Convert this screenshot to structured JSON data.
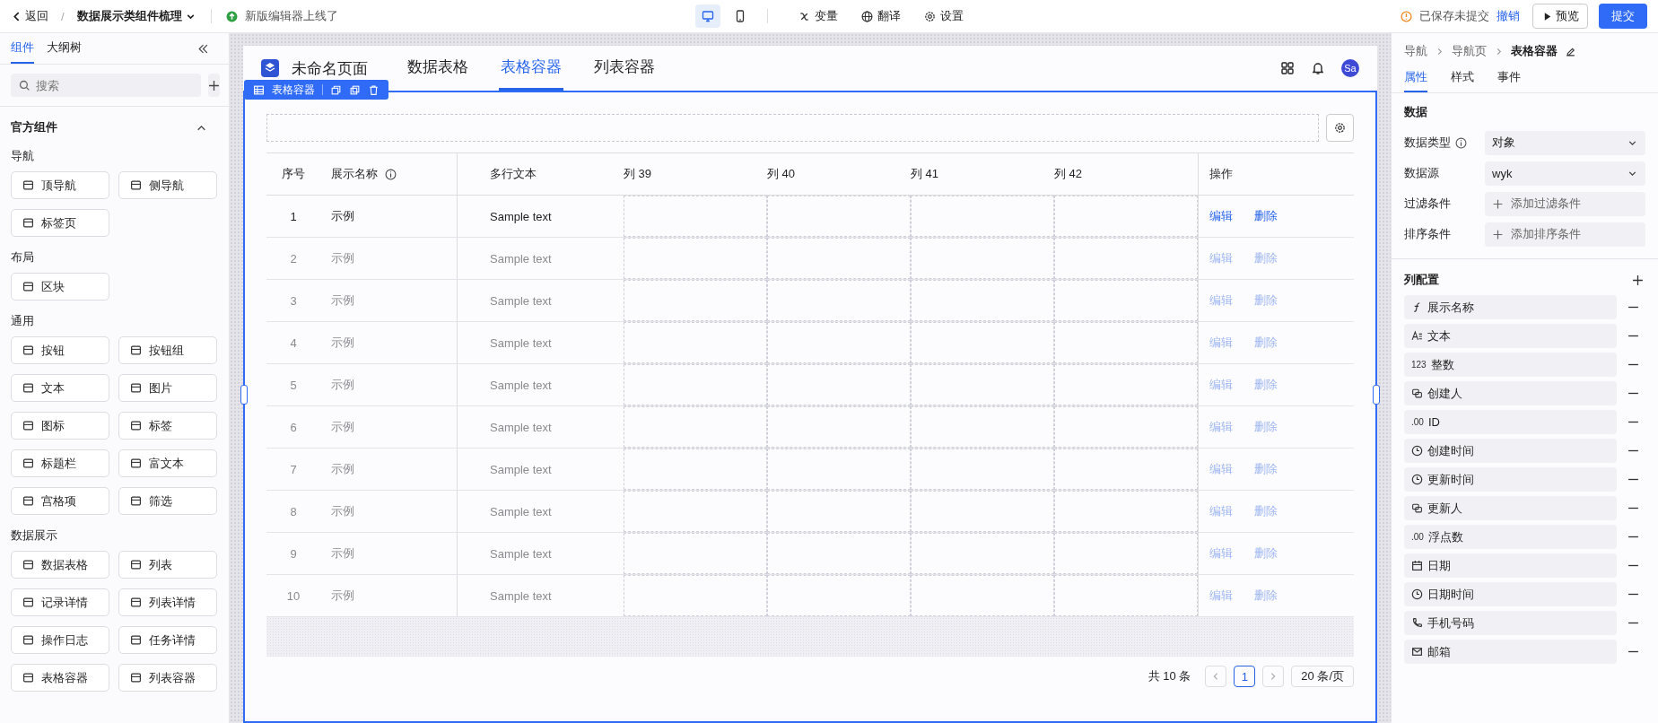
{
  "topbar": {
    "back": "返回",
    "separator": "/",
    "project": "数据展示类组件梳理",
    "notice": "新版编辑器上线了",
    "devices": [
      {
        "kind": "desktop",
        "selected": true
      },
      {
        "kind": "mobile",
        "selected": false
      }
    ],
    "tools": [
      {
        "kind": "variable",
        "label": "变量"
      },
      {
        "kind": "translate",
        "label": "翻译"
      },
      {
        "kind": "settings",
        "label": "设置"
      }
    ],
    "status": "已保存未提交",
    "undo": "撤销",
    "preview": "预览",
    "submit": "提交"
  },
  "sidebar": {
    "tabs": [
      {
        "label": "组件",
        "selected": true
      },
      {
        "label": "大纲树",
        "selected": false
      }
    ],
    "search": {
      "placeholder": "搜索"
    },
    "section": {
      "title": "官方组件",
      "expanded": true
    },
    "groups": [
      {
        "title": "导航",
        "items": [
          "顶导航",
          "侧导航",
          "标签页"
        ]
      },
      {
        "title": "布局",
        "items": [
          "区块"
        ]
      },
      {
        "title": "通用",
        "items": [
          "按钮",
          "按钮组",
          "文本",
          "图片",
          "图标",
          "标签",
          "标题栏",
          "富文本",
          "宫格项",
          "筛选"
        ]
      },
      {
        "title": "数据展示",
        "items": [
          "数据表格",
          "列表",
          "记录详情",
          "列表详情",
          "操作日志",
          "任务详情",
          "表格容器",
          "列表容器"
        ]
      }
    ]
  },
  "page": {
    "title": "未命名页面",
    "tabs": [
      {
        "label": "数据表格",
        "selected": false
      },
      {
        "label": "表格容器",
        "selected": true
      },
      {
        "label": "列表容器",
        "selected": false
      }
    ],
    "avatar": "Sa",
    "selection_toolbar": {
      "label": "表格容器"
    },
    "table": {
      "columns": [
        {
          "kind": "index",
          "label": "序号"
        },
        {
          "kind": "name",
          "label": "展示名称",
          "info": true
        },
        {
          "kind": "text",
          "label": "多行文本"
        },
        {
          "kind": "empty",
          "label": "列 39"
        },
        {
          "kind": "empty",
          "label": "列 40"
        },
        {
          "kind": "empty",
          "label": "列 41"
        },
        {
          "kind": "empty",
          "label": "列 42"
        },
        {
          "kind": "actions",
          "label": "操作"
        }
      ],
      "rows": [
        {
          "index": "1",
          "name": "示例",
          "text": "Sample text",
          "actions": [
            "编辑",
            "删除"
          ],
          "dimmed": false
        },
        {
          "index": "2",
          "name": "示例",
          "text": "Sample text",
          "actions": [
            "编辑",
            "删除"
          ],
          "dimmed": true
        },
        {
          "index": "3",
          "name": "示例",
          "text": "Sample text",
          "actions": [
            "编辑",
            "删除"
          ],
          "dimmed": true
        },
        {
          "index": "4",
          "name": "示例",
          "text": "Sample text",
          "actions": [
            "编辑",
            "删除"
          ],
          "dimmed": true
        },
        {
          "index": "5",
          "name": "示例",
          "text": "Sample text",
          "actions": [
            "编辑",
            "删除"
          ],
          "dimmed": true
        },
        {
          "index": "6",
          "name": "示例",
          "text": "Sample text",
          "actions": [
            "编辑",
            "删除"
          ],
          "dimmed": true
        },
        {
          "index": "7",
          "name": "示例",
          "text": "Sample text",
          "actions": [
            "编辑",
            "删除"
          ],
          "dimmed": true
        },
        {
          "index": "8",
          "name": "示例",
          "text": "Sample text",
          "actions": [
            "编辑",
            "删除"
          ],
          "dimmed": true
        },
        {
          "index": "9",
          "name": "示例",
          "text": "Sample text",
          "actions": [
            "编辑",
            "删除"
          ],
          "dimmed": true
        },
        {
          "index": "10",
          "name": "示例",
          "text": "Sample text",
          "actions": [
            "编辑",
            "删除"
          ],
          "dimmed": true
        }
      ]
    },
    "pagination": {
      "total": "共 10 条",
      "pages": [
        {
          "label": "1",
          "selected": true
        }
      ],
      "page_size": "20 条/页"
    }
  },
  "inspector": {
    "breadcrumb": [
      "导航",
      "导航页",
      "表格容器"
    ],
    "tabs": [
      {
        "label": "属性",
        "selected": true
      },
      {
        "label": "样式",
        "selected": false
      },
      {
        "label": "事件",
        "selected": false
      }
    ],
    "data_section": {
      "title": "数据",
      "fields": [
        {
          "kind": "select",
          "label": "数据类型",
          "info": true,
          "value": "对象"
        },
        {
          "kind": "select",
          "label": "数据源",
          "info": false,
          "value": "wyk"
        },
        {
          "kind": "add",
          "label": "过滤条件",
          "value": "添加过滤条件"
        },
        {
          "kind": "add",
          "label": "排序条件",
          "value": "添加排序条件"
        }
      ]
    },
    "columns_section": {
      "title": "列配置",
      "items": [
        {
          "kind": "formula",
          "label": "展示名称"
        },
        {
          "kind": "text",
          "label": "文本"
        },
        {
          "kind": "number",
          "tag": "123",
          "label": "整数"
        },
        {
          "kind": "user",
          "label": "创建人"
        },
        {
          "kind": "number",
          "tag": ".00",
          "label": "ID"
        },
        {
          "kind": "time",
          "label": "创建时间"
        },
        {
          "kind": "time",
          "label": "更新时间"
        },
        {
          "kind": "user",
          "label": "更新人"
        },
        {
          "kind": "number",
          "tag": ".00",
          "label": "浮点数"
        },
        {
          "kind": "date",
          "label": "日期"
        },
        {
          "kind": "time",
          "label": "日期时间"
        },
        {
          "kind": "phone",
          "label": "手机号码"
        },
        {
          "kind": "mail",
          "label": "邮箱"
        }
      ]
    }
  }
}
